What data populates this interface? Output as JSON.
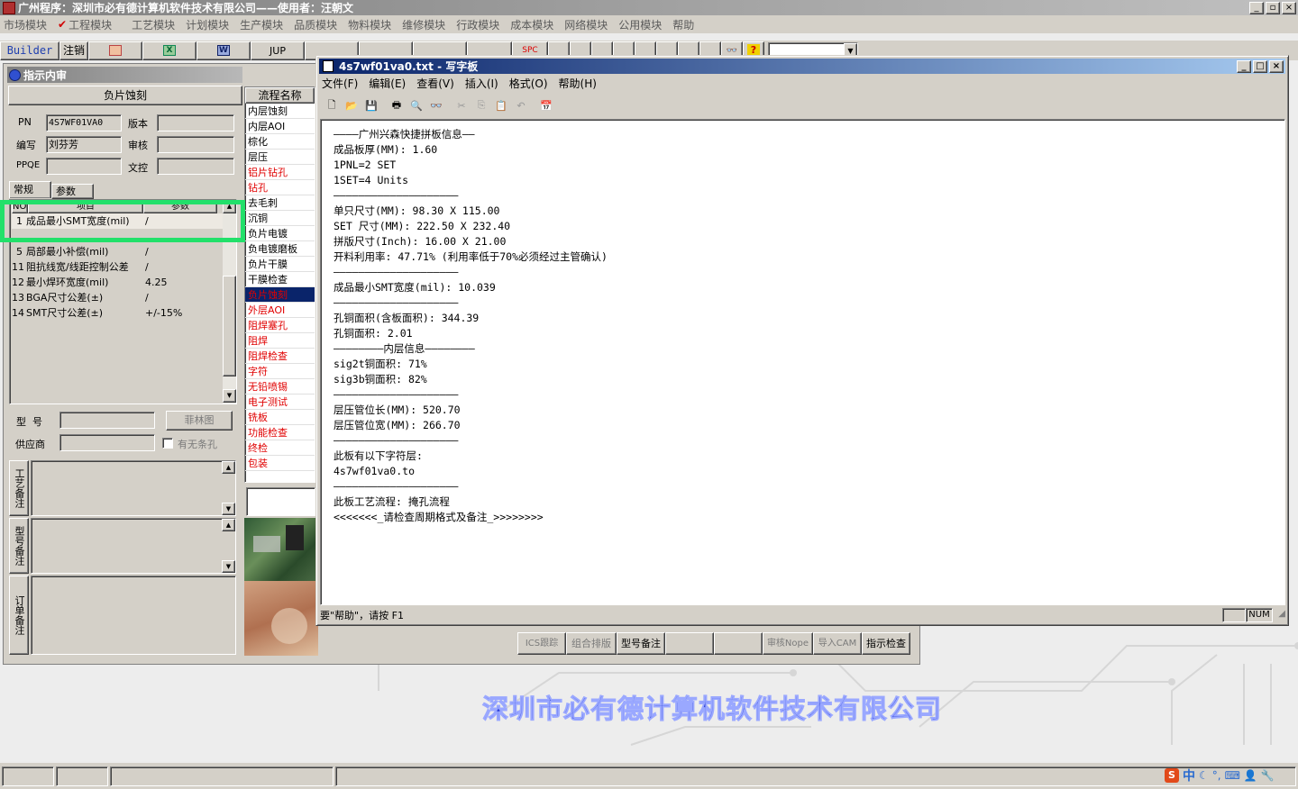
{
  "app": {
    "title": "广州程序：深圳市必有德计算机软件技术有限公司——使用者：汪朝文",
    "controls": [
      "_",
      "▫",
      "×"
    ]
  },
  "menubar": [
    "市场模块",
    "工程模块",
    "工艺模块",
    "计划模块",
    "生产模块",
    "品质模块",
    "物料模块",
    "维修模块",
    "行政模块",
    "成本模块",
    "网络模块",
    "公用模块",
    "帮助"
  ],
  "toolbar": {
    "builder": "Builder",
    "logout": "注销",
    "jup": "JUP",
    "spc": "SPC"
  },
  "left_panel": {
    "title": "指示内审",
    "subtitle": "负片蚀刻",
    "pn_label": "PN",
    "pn_value": "4S7WF01VA0",
    "version_label": "版本",
    "version_value": "",
    "writer_label": "编写",
    "writer_value": "刘芬芳",
    "audit_label": "审核",
    "audit_value": "",
    "ppqe_label": "PPQE",
    "ppqe_value": "",
    "doc_label": "文控",
    "doc_value": "",
    "tabs": [
      "常规",
      "参数"
    ],
    "grid_headers": [
      "NO",
      "项目",
      "参数"
    ],
    "grid_rows": [
      {
        "no": "1",
        "item": "成品最小SMT宽度(mil)",
        "param": "/"
      },
      {
        "no": "5",
        "item": "局部最小补偿(mil)",
        "param": "/"
      },
      {
        "no": "11",
        "item": "阻抗线宽/线距控制公差",
        "param": "/"
      },
      {
        "no": "12",
        "item": "最小焊环宽度(mil)",
        "param": "4.25"
      },
      {
        "no": "13",
        "item": "BGA尺寸公差(±)",
        "param": "/"
      },
      {
        "no": "14",
        "item": "SMT尺寸公差(±)",
        "param": "+/-15%"
      }
    ],
    "model_label": "型  号",
    "model_value": "",
    "film_btn": "菲林图",
    "supplier_label": "供应商",
    "supplier_value": "",
    "barcode_label": "有无条孔",
    "memo_labels": [
      "工艺备注",
      "型号备注",
      "订单备注"
    ]
  },
  "process": {
    "header": "流程名称",
    "items": [
      {
        "name": "内层蚀刻",
        "state": "normal"
      },
      {
        "name": "内层AOI",
        "state": "normal"
      },
      {
        "name": "棕化",
        "state": "normal"
      },
      {
        "name": "层压",
        "state": "normal"
      },
      {
        "name": "铝片钻孔",
        "state": "red"
      },
      {
        "name": "钻孔",
        "state": "red"
      },
      {
        "name": "去毛刺",
        "state": "normal"
      },
      {
        "name": "沉铜",
        "state": "normal"
      },
      {
        "name": "负片电镀",
        "state": "normal"
      },
      {
        "name": "负电镀磨板",
        "state": "normal"
      },
      {
        "name": "负片干膜",
        "state": "normal"
      },
      {
        "name": "干膜检查",
        "state": "normal"
      },
      {
        "name": "负片蚀刻",
        "state": "selected"
      },
      {
        "name": "外层AOI",
        "state": "red"
      },
      {
        "name": "阻焊塞孔",
        "state": "red"
      },
      {
        "name": "阻焊",
        "state": "red"
      },
      {
        "name": "阻焊检查",
        "state": "red"
      },
      {
        "name": "字符",
        "state": "red"
      },
      {
        "name": "无铅喷锡",
        "state": "red"
      },
      {
        "name": "电子测试",
        "state": "red"
      },
      {
        "name": "铣板",
        "state": "red"
      },
      {
        "name": "功能检查",
        "state": "red"
      },
      {
        "name": "终检",
        "state": "red"
      },
      {
        "name": "包装",
        "state": "red"
      }
    ]
  },
  "bottom_buttons": [
    "ICS跟踪",
    "组合排版",
    "型号备注",
    "",
    "",
    "审核Nope",
    "导入CAM",
    "指示检查"
  ],
  "wordpad": {
    "title": "4s7wf01va0.txt - 写字板",
    "menu": [
      "文件(F)",
      "编辑(E)",
      "查看(V)",
      "插入(I)",
      "格式(O)",
      "帮助(H)"
    ],
    "lines": [
      "————广州兴森快捷拼板信息——",
      "成品板厚(MM): 1.60",
      "1PNL=2 SET",
      "1SET=4 Units",
      "————————————————————",
      "单只尺寸(MM): 98.30 X 115.00",
      "SET 尺寸(MM): 222.50 X 232.40",
      "拼版尺寸(Inch): 16.00 X 21.00",
      "开料利用率: 47.71% (利用率低于70%必须经过主管确认)",
      "————————————————————",
      "成品最小SMT宽度(mil): 10.039",
      "————————————————————",
      "孔铜面积(含板面积): 344.39",
      "孔铜面积: 2.01",
      "————————内层信息————————",
      "sig2t铜面积: 71%",
      "sig3b铜面积: 82%",
      "————————————————————",
      "层压管位长(MM): 520.70",
      "层压管位宽(MM): 266.70",
      "————————————————————",
      "此板有以下字符层:",
      "4s7wf01va0.to",
      "————————————————————",
      "此板工艺流程: 掩孔流程",
      "<<<<<<<_请检查周期格式及备注_>>>>>>>>"
    ],
    "status": "要\"帮助\"，请按 F1",
    "num": "NUM"
  },
  "banner": "深圳市必有德计算机软件技术有限公司",
  "tray": {
    "ime": "中"
  },
  "colors": {
    "titlebar": "#0a246a",
    "highlight_box": "#22e06a",
    "red_text": "#e00000",
    "banner": "#2b3fd6"
  }
}
